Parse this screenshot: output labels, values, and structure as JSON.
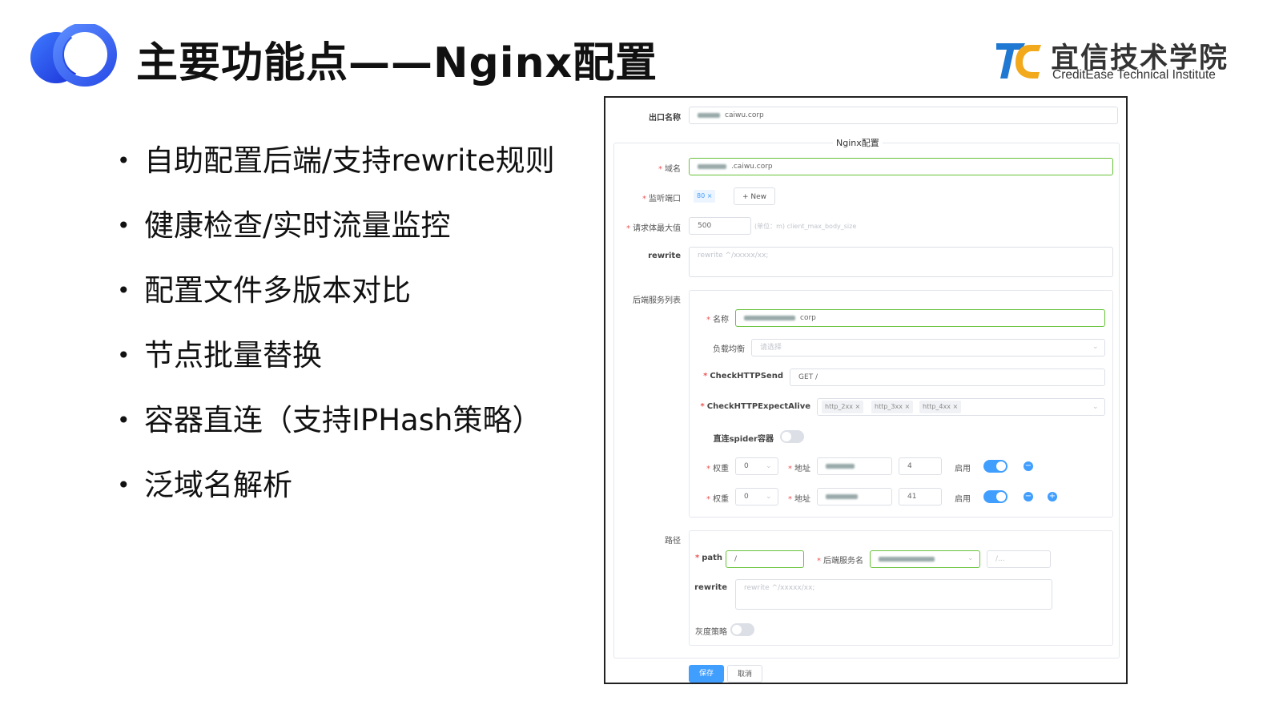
{
  "slide": {
    "title": "主要功能点——Nginx配置",
    "brand_cn": "宜信技术学院",
    "brand_en": "CreditEase Technical Institute",
    "bullet_char": "•",
    "bullets": [
      "自助配置后端/支持rewrite规则",
      "健康检查/实时流量监控",
      "配置文件多版本对比",
      "节点批量替换",
      "容器直连（支持IPHash策略）",
      "泛域名解析"
    ]
  },
  "form": {
    "exit_name_label": "出口名称",
    "exit_name_value": "caiwu.corp",
    "nginx_legend": "Nginx配置",
    "required_mark": "*",
    "domain_label": "域名",
    "domain_value": ".caiwu.corp",
    "port_label": "监听端口",
    "port_tag": "80",
    "tag_close": "×",
    "new_button": "+ New",
    "body_size_label": "请求体最大值",
    "body_size_value": "500",
    "body_size_hint": "(单位：m) client_max_body_size",
    "rewrite_label": "rewrite",
    "rewrite_placeholder": "rewrite ^/xxxxx/xx;",
    "backend_list_label": "后端服务列表",
    "backend": {
      "name_label": "名称",
      "name_value": "corp",
      "lb_label": "负载均衡",
      "lb_placeholder": "请选择",
      "send_label": "CheckHTTPSend",
      "send_value": "GET /",
      "alive_label": "CheckHTTPExpectAlive",
      "alive_tags": [
        "http_2xx",
        "http_3xx",
        "http_4xx"
      ],
      "direct_label": "直连spider容器",
      "direct_on": false,
      "servers": [
        {
          "weight_label": "权重",
          "weight": "0",
          "addr_label": "地址",
          "port": "4",
          "enable_label": "启用",
          "enabled": true
        },
        {
          "weight_label": "权重",
          "weight": "0",
          "addr_label": "地址",
          "port": "41",
          "enable_label": "启用",
          "enabled": true
        }
      ],
      "remove_symbol": "−",
      "add_symbol": "+"
    },
    "route_label": "路径",
    "route": {
      "path_label": "path",
      "path_value": "/",
      "service_label": "后端服务名",
      "extra_placeholder": "/...",
      "rewrite_label": "rewrite",
      "rewrite_placeholder": "rewrite ^/xxxxx/xx;",
      "gray_label": "灰度策略",
      "gray_on": false
    },
    "save_button": "保存",
    "cancel_button": "取消"
  }
}
